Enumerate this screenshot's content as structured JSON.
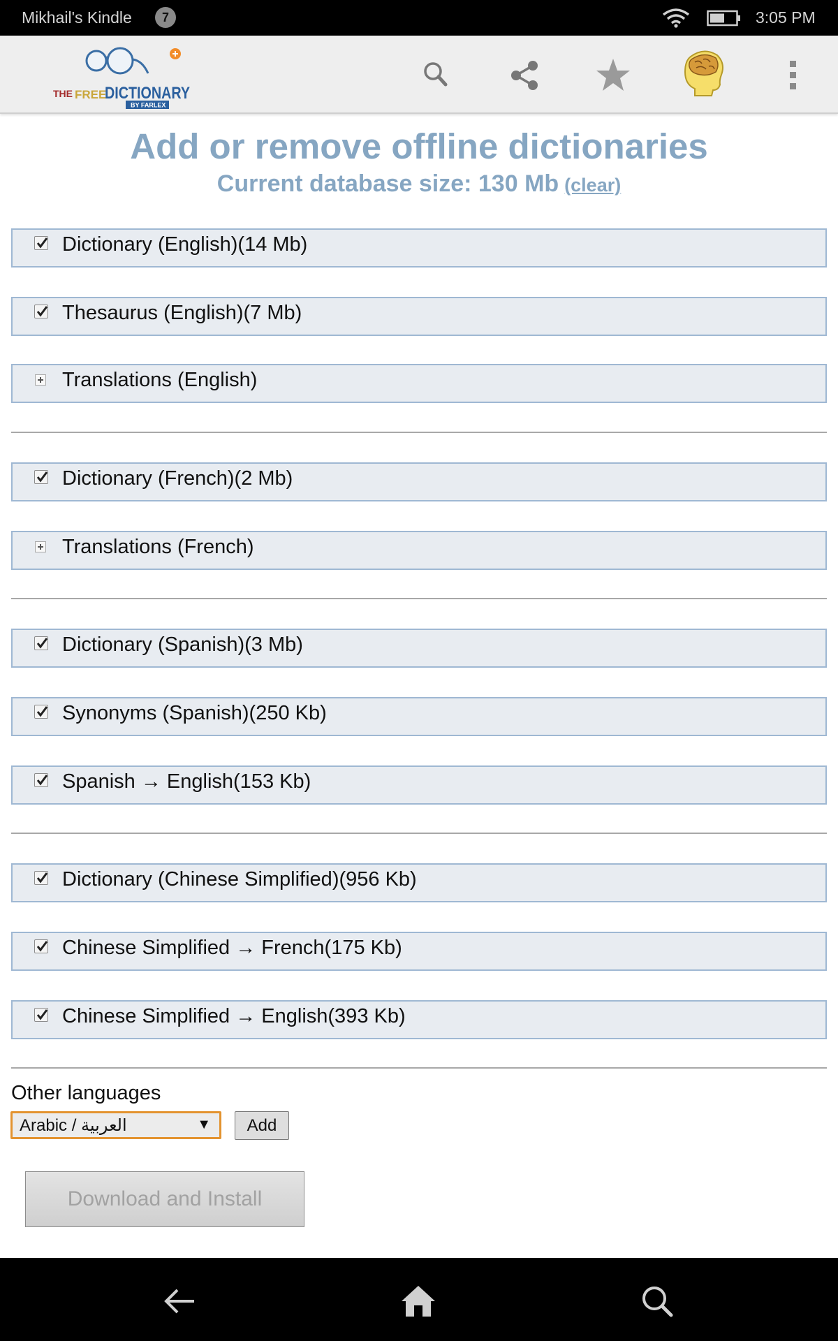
{
  "status_bar": {
    "device_name": "Mikhail's Kindle",
    "notification_count": "7",
    "time": "3:05 PM",
    "icons": [
      "wifi-icon",
      "battery-icon"
    ]
  },
  "toolbar": {
    "logo": {
      "line_the": "THE",
      "line_free": "FREE",
      "line_dictionary": "DICTIONARY",
      "line_by": "BY FARLEX"
    },
    "icons": [
      "search-icon",
      "share-icon",
      "star-icon",
      "brain-icon",
      "more-icon"
    ]
  },
  "page": {
    "title": "Add or remove offline dictionaries",
    "db_size_text": "Current database size: 130 Mb",
    "clear_link": "(clear)"
  },
  "groups": [
    {
      "items": [
        {
          "label": "Dictionary (English)(14 Mb)",
          "control": "checkbox",
          "checked": true
        },
        {
          "label": "Thesaurus (English)(7 Mb)",
          "control": "checkbox",
          "checked": true
        },
        {
          "label": "Translations (English)",
          "control": "expand"
        }
      ]
    },
    {
      "items": [
        {
          "label": "Dictionary (French)(2 Mb)",
          "control": "checkbox",
          "checked": true
        },
        {
          "label": "Translations (French)",
          "control": "expand"
        }
      ]
    },
    {
      "items": [
        {
          "label": "Dictionary (Spanish)(3 Mb)",
          "control": "checkbox",
          "checked": true
        },
        {
          "label": "Synonyms (Spanish)(250 Kb)",
          "control": "checkbox",
          "checked": true
        },
        {
          "label": "Spanish → English(153 Kb)",
          "control": "checkbox",
          "checked": true
        }
      ]
    },
    {
      "items": [
        {
          "label": "Dictionary (Chinese Simplified)(956 Kb)",
          "control": "checkbox",
          "checked": true
        },
        {
          "label": "Chinese Simplified → French(175 Kb)",
          "control": "checkbox",
          "checked": true
        },
        {
          "label": "Chinese Simplified → English(393 Kb)",
          "control": "checkbox",
          "checked": true
        }
      ]
    }
  ],
  "other_languages": {
    "label": "Other languages",
    "selected": "Arabic / العربية",
    "add_label": "Add"
  },
  "download_label": "Download and Install",
  "nav_bar": {
    "icons": [
      "back-arrow-icon",
      "home-icon",
      "search-icon"
    ]
  },
  "colors": {
    "heading": "#86a6c2",
    "row_bg": "#e8ecf1",
    "row_border": "#9fb8d3",
    "select_border": "#e3932f"
  }
}
